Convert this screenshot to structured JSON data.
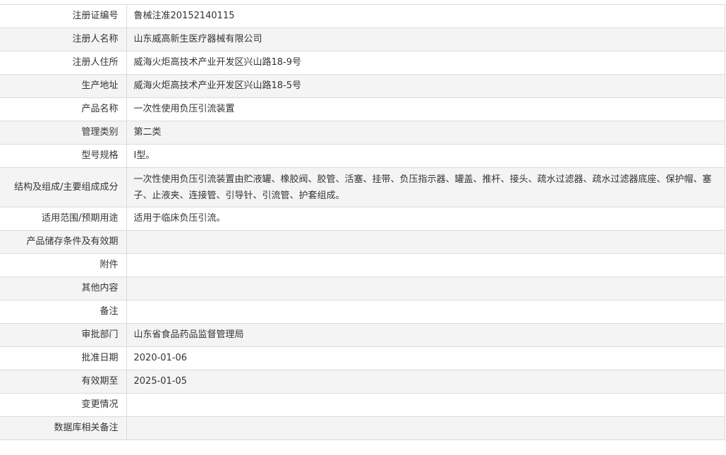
{
  "record": {
    "rows": [
      {
        "label": "注册证编号",
        "value": "鲁械注准20152140115"
      },
      {
        "label": "注册人名称",
        "value": "山东威高新生医疗器械有限公司"
      },
      {
        "label": "注册人住所",
        "value": "威海火炬高技术产业开发区兴山路18-9号"
      },
      {
        "label": "生产地址",
        "value": "威海火炬高技术产业开发区兴山路18-5号"
      },
      {
        "label": "产品名称",
        "value": "一次性使用负压引流装置"
      },
      {
        "label": "管理类别",
        "value": "第二类"
      },
      {
        "label": "型号规格",
        "value": "Ⅰ型。"
      },
      {
        "label": "结构及组成/主要组成成分",
        "value": "一次性使用负压引流装置由贮液罐、橡胶阀、胶管、活塞、挂带、负压指示器、罐盖、推杆、接头、疏水过滤器、疏水过滤器底座、保护帽、塞子、止液夹、连接管、引导针、引流管、护套组成。"
      },
      {
        "label": "适用范围/预期用途",
        "value": "适用于临床负压引流。"
      },
      {
        "label": "产品储存条件及有效期",
        "value": ""
      },
      {
        "label": "附件",
        "value": ""
      },
      {
        "label": "其他内容",
        "value": ""
      },
      {
        "label": "备注",
        "value": ""
      },
      {
        "label": "审批部门",
        "value": "山东省食品药品监督管理局"
      },
      {
        "label": "批准日期",
        "value": "2020-01-06"
      },
      {
        "label": "有效期至",
        "value": "2025-01-05"
      },
      {
        "label": "变更情况",
        "value": ""
      },
      {
        "label": "数据库相关备注",
        "value": ""
      }
    ]
  }
}
